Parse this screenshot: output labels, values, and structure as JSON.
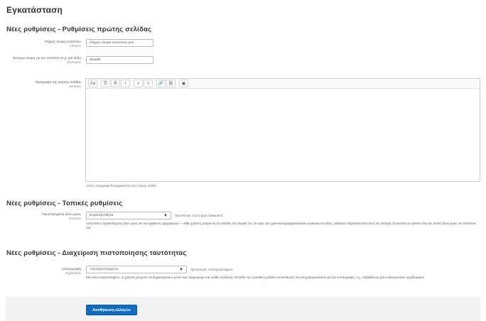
{
  "page_title": "Εγκατάσταση",
  "sections": {
    "frontpage": {
      "heading": "Νέες ρυθμίσεις - Ρυθμίσεις πρώτης σελίδας",
      "fullname": {
        "label": "Πλήρες όνομα ιστοτόπου",
        "default": "fullname",
        "value": "Πλήρες όνομα ιστοτόπου μου"
      },
      "shortname": {
        "label": "Σύντομο όνομα για τον ιστοτόπο (π.χ. μία λέξη)",
        "default": "shortname",
        "value": "Moodle"
      },
      "summary": {
        "label": "Περιγραφή της πρώτης σελίδας",
        "default": "summary",
        "note": "Αυτή η περιγραφή θα εμφανίζεται στην πρώτη σελίδα"
      }
    },
    "location": {
      "heading": "Νέες ρυθμίσεις - Τοπικές ρυθμίσεις",
      "timezone": {
        "label": "Προεπιλεγμένη ζώνη ώρας",
        "default": "timezone",
        "value": "Ευρώπη/Αθήνα",
        "default_note": "Προεπιλογή: Ζώνη ώρας διακομιστή",
        "description": "Αυτή είναι η προεπιλεγμένη ζώνη ώρας για την εμφάνιση ημερομηνιών — κάθε χρήστης μπορεί να την αλλάξει στο προφίλ του. Οι ώρες των χρονοπρογραμματισμένων εργασιών και άλλες ρυθμίσεις εξαρτώνται από αυτή την επιλογή. Συνιστάται να ορίσετε εδώ την τοπική ζώνη ώρας του ιστοτόπου σας."
      }
    },
    "auth": {
      "heading": "Νέες ρυθμίσεις - Διαχείριση πιστοποίησης ταυτότητας",
      "registerauth": {
        "label": "Αυτοεγγραφή",
        "default": "registerauth",
        "value": "Απενεργοποιημένο",
        "default_note": "Προεπιλογή: Απενεργοποιημένο",
        "description": "Εάν είναι ενεργοποιημένο, οι χρήστες μπορούν να δημιουργήσουν μόνοι τους λογαριασμό στη σελίδα σύνδεσης. Επιλέξτε την πρόσθετη μέθοδο πιστοποίησης που θα χρησιμοποιείται για την αυτοεγγραφή, π.χ. επιβεβαίωση μέσω ηλεκτρονικού ταχυδρομείου."
      }
    }
  },
  "editor_toolbar": [
    "Αa",
    "☰",
    "B",
    "I",
    "≡",
    "≡",
    "🔗",
    "⛓",
    "▣"
  ],
  "save_button": "Αποθήκευση αλλαγών",
  "colors": {
    "accent": "#0f6cbf",
    "footer_bg": "#f2f2f2"
  }
}
